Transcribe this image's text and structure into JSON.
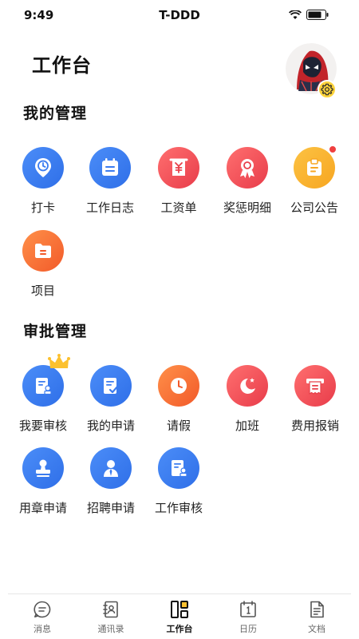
{
  "status_bar": {
    "time": "9:49",
    "carrier": "T-DDD"
  },
  "header": {
    "title": "工作台"
  },
  "management": {
    "title": "我的管理",
    "items": [
      {
        "label": "打卡",
        "icon": "location-clock-icon",
        "color": "#3a7bf0"
      },
      {
        "label": "工作日志",
        "icon": "calendar-log-icon",
        "color": "#3a7bf0"
      },
      {
        "label": "工资单",
        "icon": "salary-scroll-icon",
        "color": "#ef4a53"
      },
      {
        "label": "奖惩明细",
        "icon": "award-ribbon-icon",
        "color": "#ef4a53"
      },
      {
        "label": "公司公告",
        "icon": "clipboard-notice-icon",
        "color": "#f9b13a",
        "has_dot": true
      },
      {
        "label": "项目",
        "icon": "folder-icon",
        "color": "#f46f33"
      }
    ]
  },
  "approval": {
    "title": "审批管理",
    "items": [
      {
        "label": "我要审核",
        "icon": "review-document-icon",
        "color": "#3a7bf0",
        "has_crown": true
      },
      {
        "label": "我的申请",
        "icon": "application-check-icon",
        "color": "#3a7bf0"
      },
      {
        "label": "请假",
        "icon": "clock-icon",
        "color": "#f46f33"
      },
      {
        "label": "加班",
        "icon": "moon-star-icon",
        "color": "#ef4a53"
      },
      {
        "label": "费用报销",
        "icon": "receipt-icon",
        "color": "#ef4a53"
      },
      {
        "label": "用章申请",
        "icon": "stamp-icon",
        "color": "#3a7bf0"
      },
      {
        "label": "招聘申请",
        "icon": "recruit-person-icon",
        "color": "#3a7bf0"
      },
      {
        "label": "工作审核",
        "icon": "work-review-icon",
        "color": "#3a7bf0"
      }
    ]
  },
  "tabs": [
    {
      "label": "消息",
      "icon": "message-icon",
      "active": false
    },
    {
      "label": "通讯录",
      "icon": "contacts-icon",
      "active": false
    },
    {
      "label": "工作台",
      "icon": "workbench-icon",
      "active": true
    },
    {
      "label": "日历",
      "icon": "calendar-icon",
      "active": false
    },
    {
      "label": "文档",
      "icon": "document-icon",
      "active": false
    }
  ]
}
